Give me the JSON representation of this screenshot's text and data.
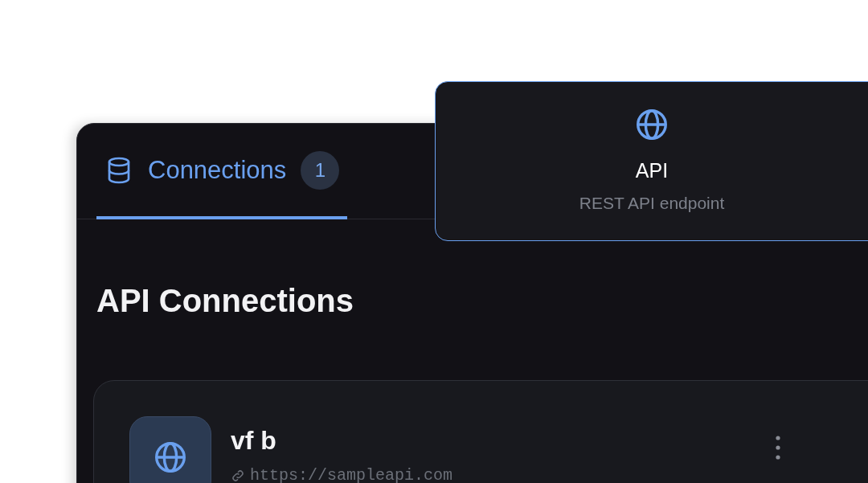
{
  "tabs": [
    {
      "label": "Connections",
      "badge": "1",
      "selected": true
    }
  ],
  "popup": {
    "title": "API",
    "subtitle": "REST API endpoint"
  },
  "heading": "API Connections",
  "connections": [
    {
      "name": "vf b",
      "url": "https://sampleapi.com"
    }
  ]
}
